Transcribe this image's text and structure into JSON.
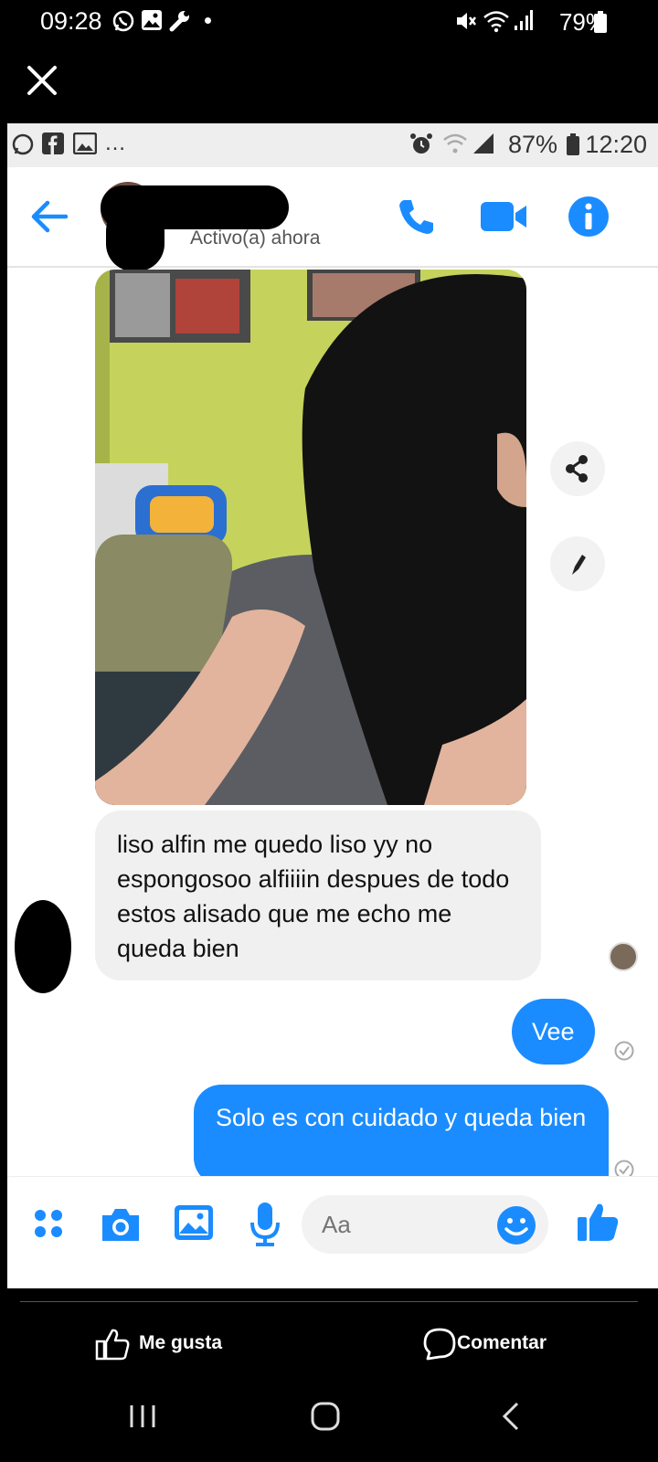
{
  "outer_status": {
    "time": "09:28",
    "battery": "79%"
  },
  "close_label": "×",
  "inner_status": {
    "battery": "87%",
    "time": "12:20"
  },
  "chat_header": {
    "contact_status": "Activo(a) ahora"
  },
  "messages": {
    "incoming_text": "liso   alfin me quedo liso yy no espongosoo alfiiiin despues de todo estos alisado que me echo me queda bien",
    "outgoing_1": "Vee",
    "outgoing_2": "Solo es con cuidado y queda bien"
  },
  "composer": {
    "placeholder": "Aa"
  },
  "facebook_bar": {
    "like_label": "Me gusta",
    "comment_label": "Comentar"
  },
  "colors": {
    "messenger_blue": "#1a8cff",
    "incoming_bubble": "#f0f0f0"
  }
}
